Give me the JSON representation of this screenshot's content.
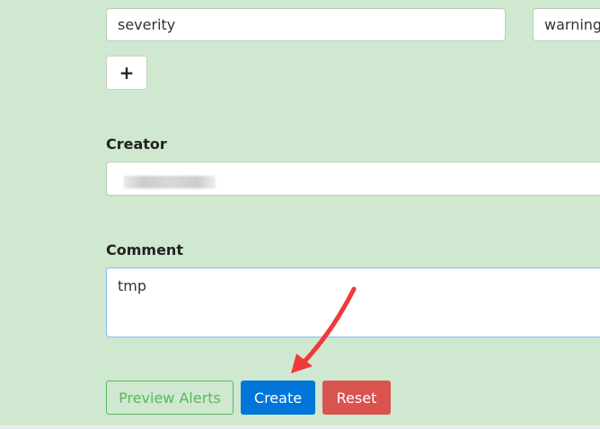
{
  "label_row": {
    "key": "severity",
    "value": "warning"
  },
  "add_button": {
    "label": "+"
  },
  "creator": {
    "label": "Creator",
    "value_redacted": true
  },
  "comment": {
    "label": "Comment",
    "value": "tmp"
  },
  "actions": {
    "preview": "Preview Alerts",
    "create": "Create",
    "reset": "Reset"
  },
  "colors": {
    "create": "#0275d8",
    "reset": "#d9534f",
    "preview": "#5cb85c",
    "background": "#cfe8cf",
    "annotation_arrow": "#f03a3a"
  }
}
